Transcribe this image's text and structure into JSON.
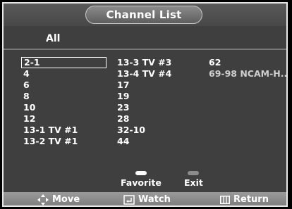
{
  "title": "Channel List",
  "tab": "All",
  "channels": {
    "col1": [
      "2-1",
      "4",
      "6",
      "8",
      "10",
      "12",
      "13-1 TV #1",
      "13-2 TV #1"
    ],
    "col2": [
      "13-3 TV #3",
      "13-4 TV #4",
      "17",
      "19",
      "23",
      "28",
      "32-10",
      "44"
    ],
    "col3": [
      "62",
      "69-98 NCAM-H.."
    ]
  },
  "selected_channel": "2-1",
  "legend": {
    "favorite": "Favorite",
    "favorite_button_color": "#ffffff",
    "exit": "Exit",
    "exit_button_color": "#8c8c8c"
  },
  "help": {
    "move": "Move",
    "move_icon": "dpad-arrows-icon",
    "watch": "Watch",
    "watch_icon": "enter-icon",
    "return": "Return",
    "return_icon": "menu-icon"
  },
  "colors": {
    "panel_background": "#3f3f3f",
    "help_bar": "#8a8a8a",
    "text": "#ffffff"
  }
}
